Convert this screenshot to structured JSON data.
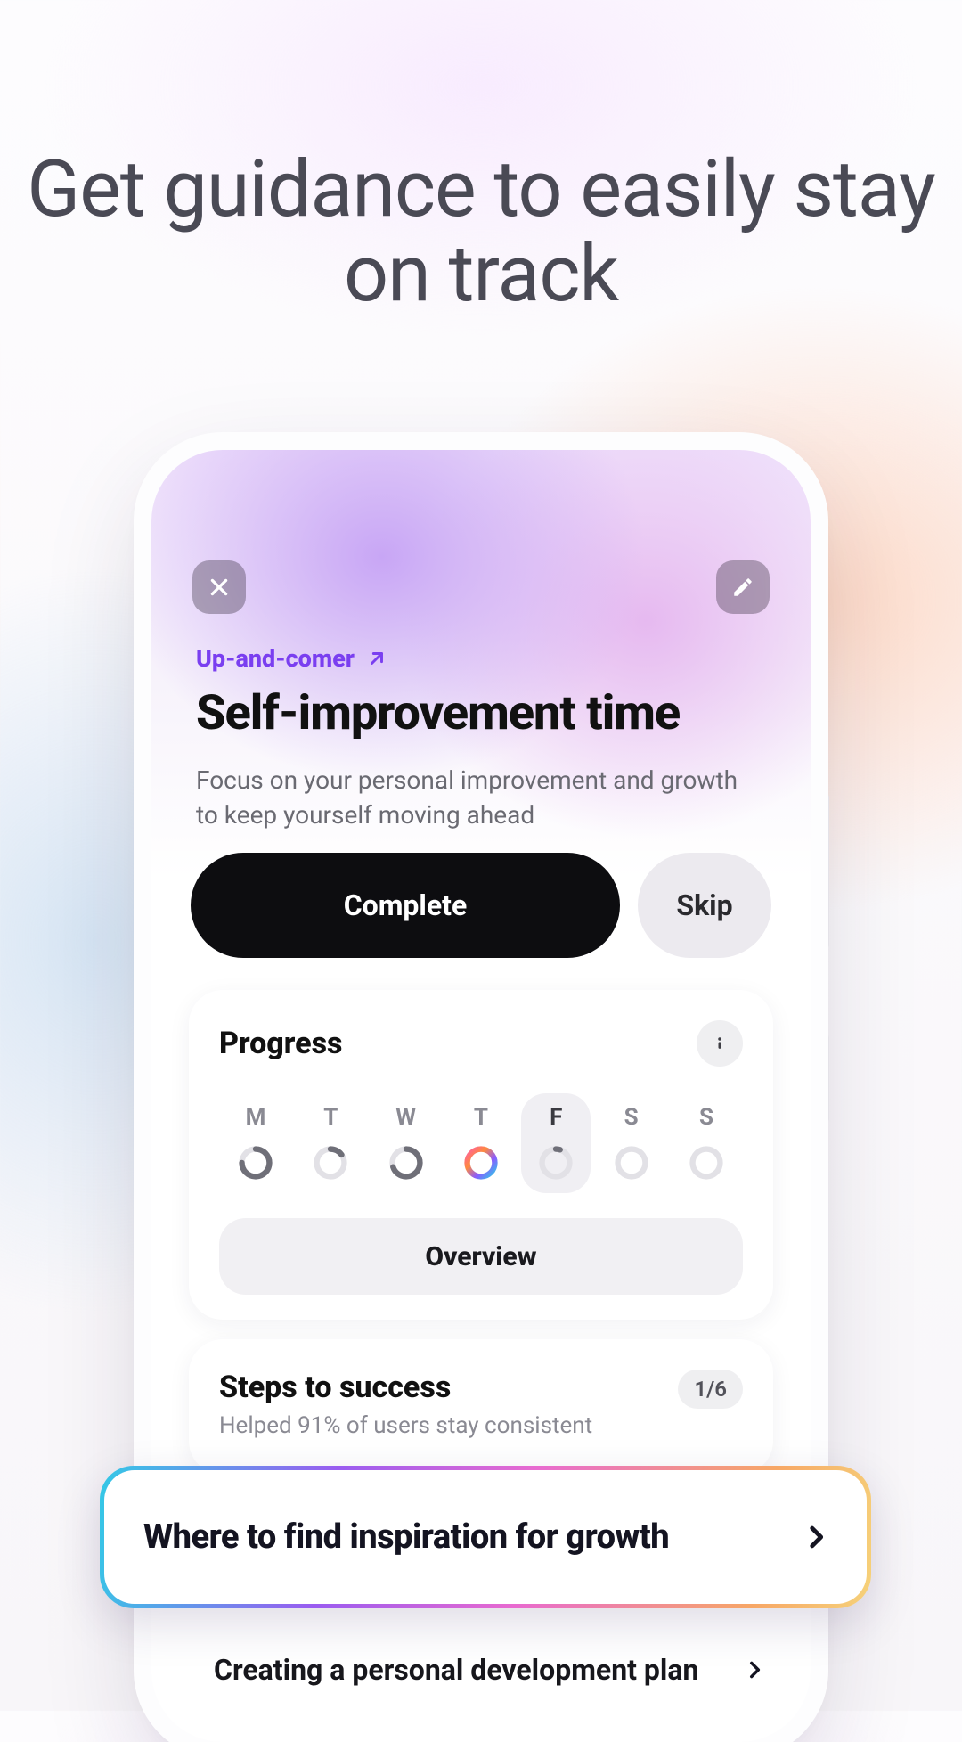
{
  "headline": "Get guidance to easily stay on track",
  "detail": {
    "category": "Up-and-comer",
    "title": "Self-improvement time",
    "description": "Focus on your personal improvement and growth to keep yourself moving ahead",
    "actions": {
      "complete": "Complete",
      "skip": "Skip"
    }
  },
  "progress": {
    "title": "Progress",
    "overview_label": "Overview",
    "days": [
      {
        "label": "M",
        "percent": 75,
        "style": "gray",
        "selected": false
      },
      {
        "label": "T",
        "percent": 15,
        "style": "gray",
        "selected": false
      },
      {
        "label": "W",
        "percent": 70,
        "style": "gray",
        "selected": false
      },
      {
        "label": "T",
        "percent": 100,
        "style": "gradient",
        "selected": false
      },
      {
        "label": "F",
        "percent": 5,
        "style": "gray",
        "selected": true
      },
      {
        "label": "S",
        "percent": 0,
        "style": "empty",
        "selected": false
      },
      {
        "label": "S",
        "percent": 0,
        "style": "empty",
        "selected": false
      }
    ]
  },
  "steps": {
    "title": "Steps to success",
    "subtitle": "Helped 91% of users stay consistent",
    "count_label": "1/6",
    "items": [
      {
        "label": "Where to find inspiration for growth",
        "highlight": true
      },
      {
        "label": "Creating a personal development plan",
        "highlight": false
      }
    ]
  }
}
